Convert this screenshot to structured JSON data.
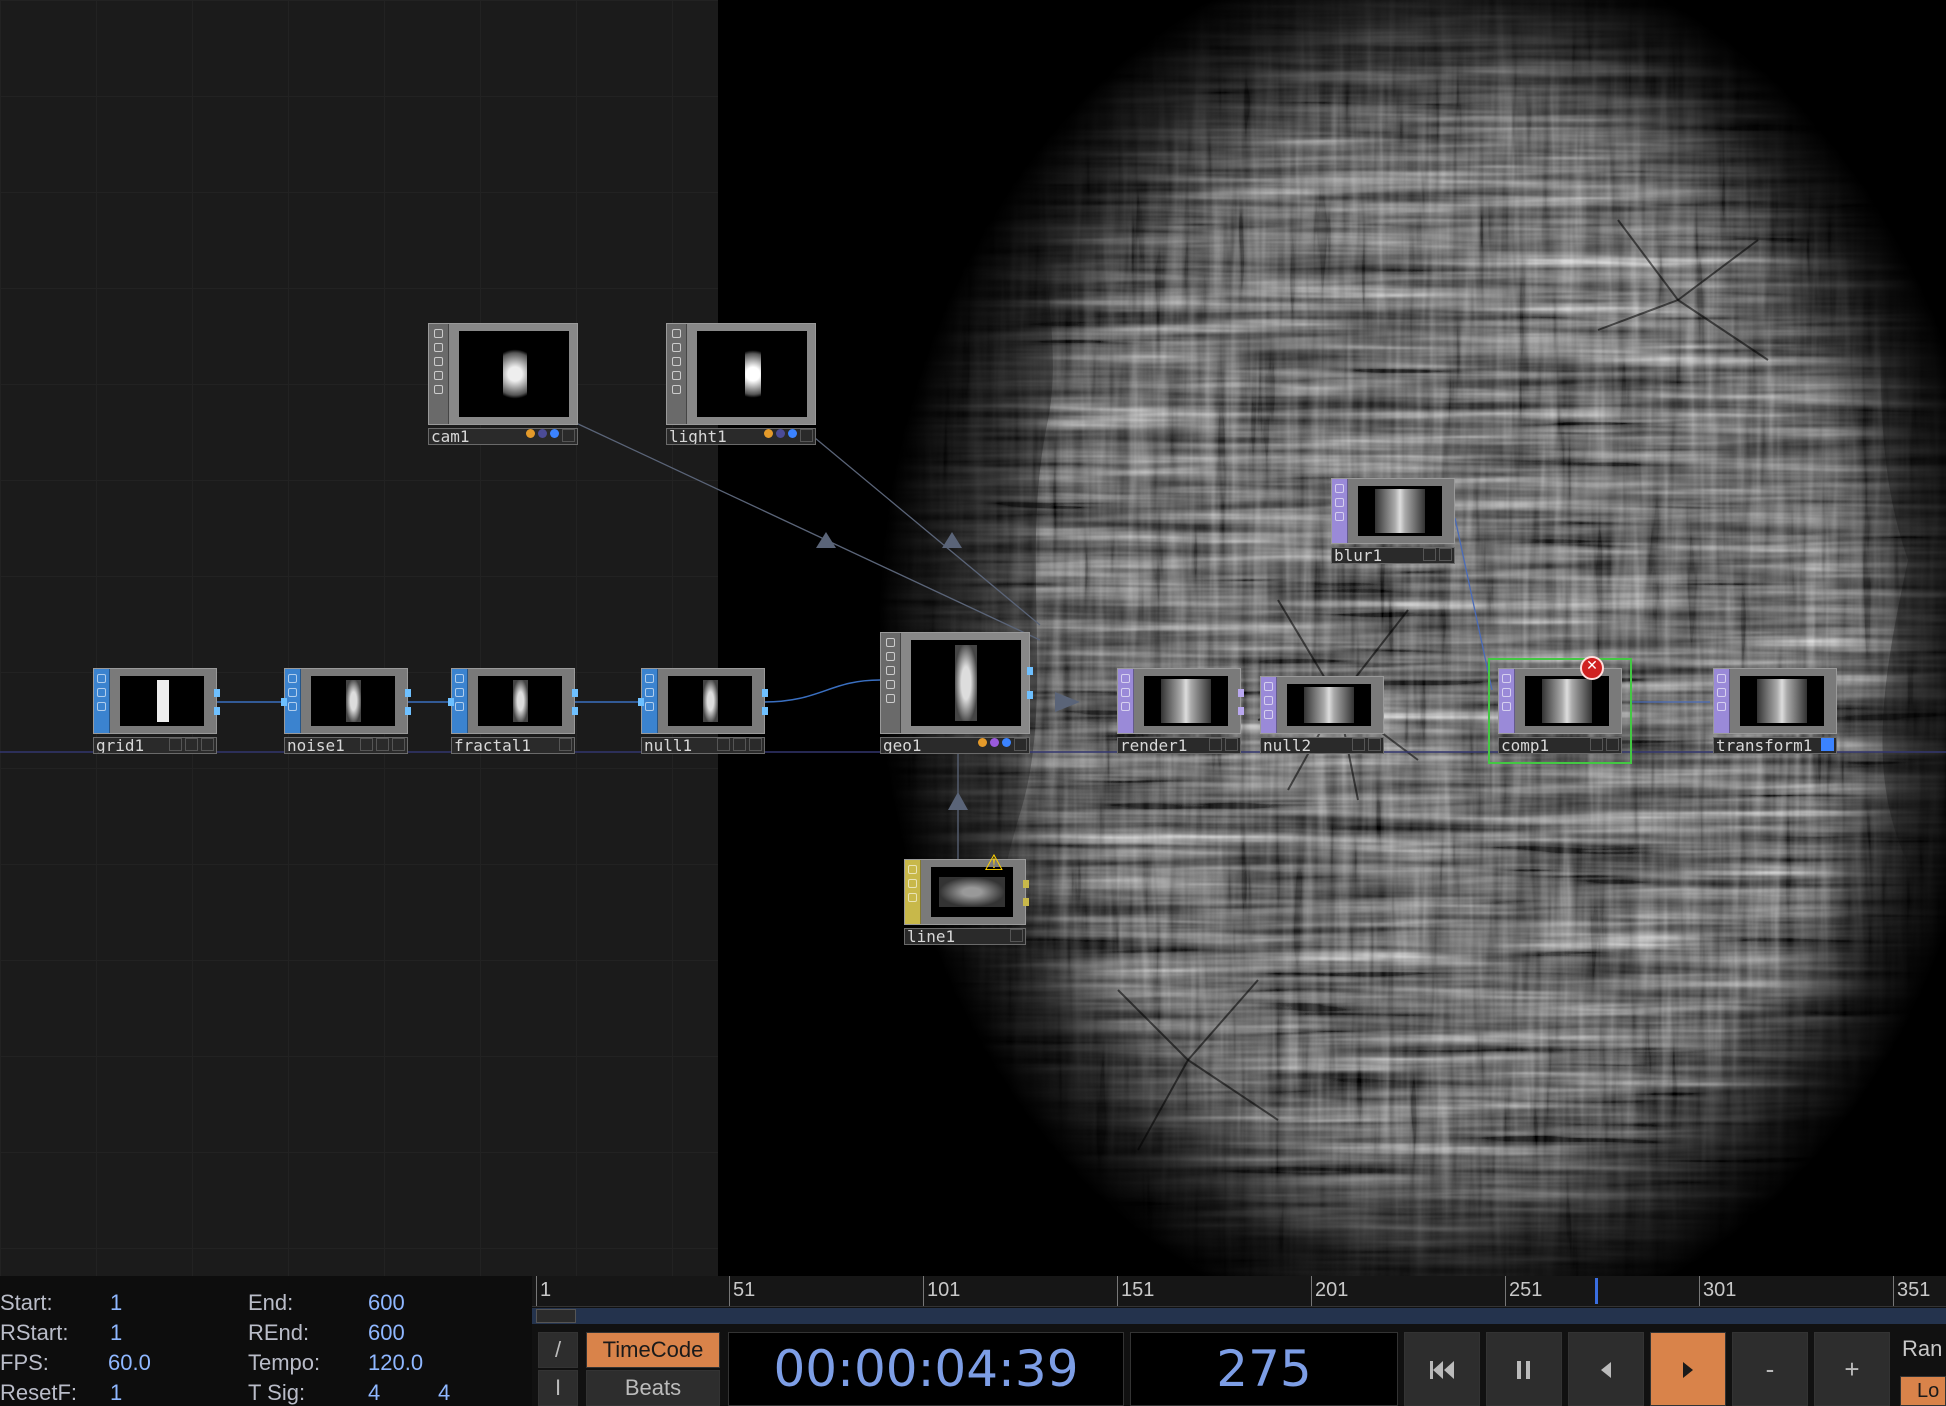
{
  "nodes": {
    "cam1": {
      "label": "cam1",
      "kind": "camera"
    },
    "light1": {
      "label": "light1",
      "kind": "light"
    },
    "grid1": {
      "label": "grid1"
    },
    "noise1": {
      "label": "noise1"
    },
    "fractal1": {
      "label": "fractal1"
    },
    "null1": {
      "label": "null1"
    },
    "geo1": {
      "label": "geo1",
      "kind": "geometry"
    },
    "line1": {
      "label": "line1",
      "status": "warning"
    },
    "blur1": {
      "label": "blur1"
    },
    "render1": {
      "label": "render1"
    },
    "null2": {
      "label": "null2"
    },
    "comp1": {
      "label": "comp1",
      "status": "error",
      "selected": true
    },
    "transform1": {
      "label": "transform1"
    }
  },
  "icons": {
    "warning": "warning-icon",
    "error": "error-icon",
    "play": "play-icon",
    "pause": "pause-icon",
    "rewind": "skip-to-start-icon",
    "step_back": "step-back-icon",
    "step_forward": "step-forward-icon"
  },
  "colors": {
    "tex_top_family": "#3b83cf",
    "tex_family": "#9a8ad8",
    "sop_family": "#c8b84a",
    "selection": "#43c843",
    "error": "#d02020",
    "warning": "#ffd200",
    "active_button": "#d9834a",
    "timecode_text": "#7d9ee6"
  },
  "range": {
    "start_label": "Start:",
    "start_value": "1",
    "rstart_label": "RStart:",
    "rstart_value": "1",
    "fps_label": "FPS:",
    "fps_value": "60.0",
    "resetf_label": "ResetF:",
    "resetf_value": "1",
    "end_label": "End:",
    "end_value": "600",
    "rend_label": "REnd:",
    "rend_value": "600",
    "tempo_label": "Tempo:",
    "tempo_value": "120.0",
    "tsig_label": "T Sig:",
    "tsig_num": "4",
    "tsig_den": "4"
  },
  "ruler": [
    "1",
    "51",
    "101",
    "151",
    "201",
    "251",
    "301",
    "351"
  ],
  "timeline": {
    "current_frame": 275,
    "timecode_button": "TimeCode",
    "beats_button": "Beats",
    "timecode": "00:00:04:39",
    "frame": "275",
    "slash_button": "/",
    "cursor_button": "I",
    "minus_button": "-",
    "plus_button": "+",
    "range_label": "Ran",
    "loop_label": "Lo"
  }
}
